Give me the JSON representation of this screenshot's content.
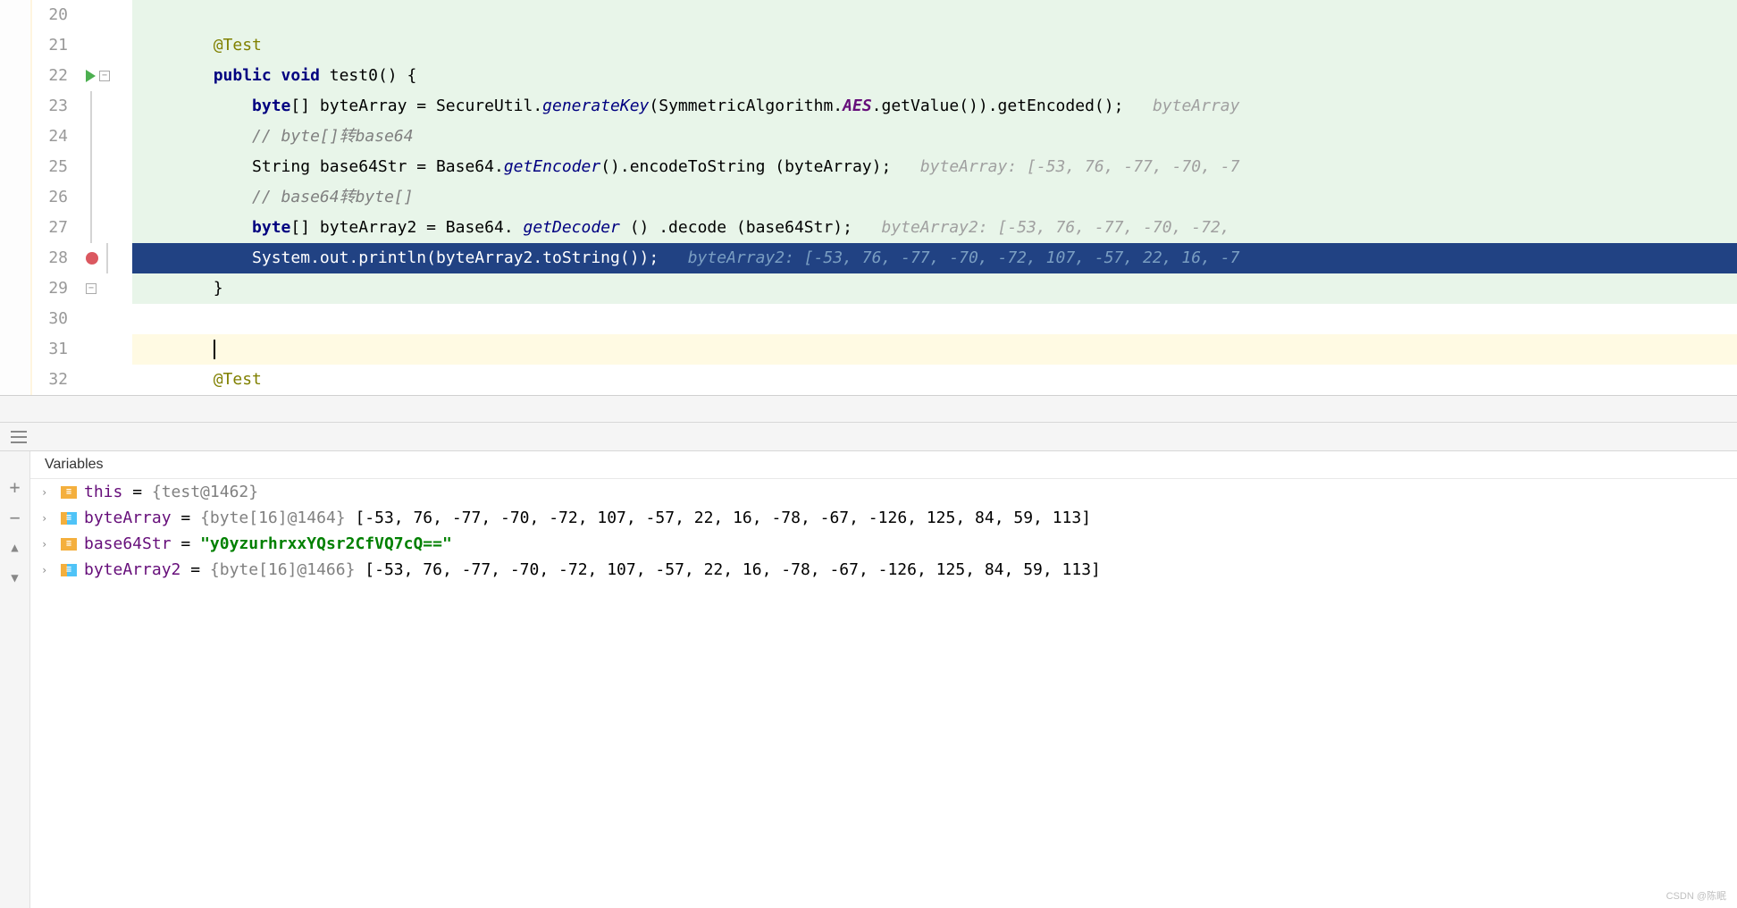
{
  "editor": {
    "lines": [
      {
        "num": "20",
        "bg": "green",
        "indent": "",
        "content": ""
      },
      {
        "num": "21",
        "bg": "green",
        "indent": "        ",
        "segments": [
          {
            "cls": "anno",
            "t": "@Test"
          }
        ]
      },
      {
        "num": "22",
        "bg": "green",
        "run": true,
        "fold": "-",
        "indent": "        ",
        "segments": [
          {
            "cls": "kw",
            "t": "public void"
          },
          {
            "cls": "",
            "t": " test0() {"
          }
        ]
      },
      {
        "num": "23",
        "bg": "green",
        "foldline": true,
        "indent": "            ",
        "segments": [
          {
            "cls": "kw",
            "t": "byte"
          },
          {
            "cls": "",
            "t": "[] byteArray = SecureUtil."
          },
          {
            "cls": "static-ital",
            "t": "generateKey"
          },
          {
            "cls": "",
            "t": "(SymmetricAlgorithm."
          },
          {
            "cls": "const-ital",
            "t": "AES"
          },
          {
            "cls": "",
            "t": ".getValue()).getEncoded();   "
          },
          {
            "cls": "hint",
            "t": "byteArray"
          }
        ]
      },
      {
        "num": "24",
        "bg": "green",
        "foldline": true,
        "indent": "            ",
        "segments": [
          {
            "cls": "comment",
            "t": "// byte[]转base64"
          }
        ]
      },
      {
        "num": "25",
        "bg": "green",
        "foldline": true,
        "indent": "            ",
        "segments": [
          {
            "cls": "",
            "t": "String base64Str = Base64."
          },
          {
            "cls": "static-ital",
            "t": "getEncoder"
          },
          {
            "cls": "",
            "t": "().encodeToString (byteArray);   "
          },
          {
            "cls": "hint",
            "t": "byteArray: [-53, 76, -77, -70, -7"
          }
        ]
      },
      {
        "num": "26",
        "bg": "green",
        "foldline": true,
        "indent": "            ",
        "segments": [
          {
            "cls": "comment",
            "t": "// base64转byte[]"
          }
        ]
      },
      {
        "num": "27",
        "bg": "green",
        "foldline": true,
        "indent": "            ",
        "segments": [
          {
            "cls": "kw",
            "t": "byte"
          },
          {
            "cls": "",
            "t": "[] byteArray2 = Base64. "
          },
          {
            "cls": "static-ital",
            "t": "getDecoder"
          },
          {
            "cls": "",
            "t": " () .decode (base64Str);   "
          },
          {
            "cls": "hint",
            "t": "byteArray2: [-53, 76, -77, -70, -72,"
          }
        ]
      },
      {
        "num": "28",
        "bg": "selected",
        "breakpoint": true,
        "foldline": true,
        "indent": "            ",
        "segments": [
          {
            "cls": "",
            "t": "System."
          },
          {
            "cls": "kw-inline",
            "t": "out"
          },
          {
            "cls": "",
            "t": ".println(byteArray2.toString());   "
          },
          {
            "cls": "hint-inline",
            "t": "byteArray2: [-53, 76, -77, -70, -72, 107, -57, 22, 16, -7"
          }
        ]
      },
      {
        "num": "29",
        "bg": "green",
        "fold": "-",
        "indent": "        ",
        "segments": [
          {
            "cls": "",
            "t": "}"
          }
        ]
      },
      {
        "num": "30",
        "bg": "none",
        "indent": "",
        "content": ""
      },
      {
        "num": "31",
        "bg": "highlight",
        "cursor": true,
        "indent": "        "
      },
      {
        "num": "32",
        "bg": "none",
        "indent": "        ",
        "segments": [
          {
            "cls": "anno",
            "t": "@Test"
          }
        ]
      }
    ]
  },
  "debugger": {
    "tab_label": "Variables",
    "vars": [
      {
        "icon": "obj",
        "name": "this",
        "eq": " = ",
        "gray": "{test@1462}",
        "rest": ""
      },
      {
        "icon": "arr",
        "name": "byteArray",
        "eq": " = ",
        "gray": "{byte[16]@1464} ",
        "rest": "[-53, 76, -77, -70, -72, 107, -57, 22, 16, -78, -67, -126, 125, 84, 59, 113]"
      },
      {
        "icon": "obj",
        "name": "base64Str",
        "eq": " = ",
        "green": "\"y0yzurhrxxYQsr2CfVQ7cQ==\""
      },
      {
        "icon": "arr",
        "name": "byteArray2",
        "eq": " = ",
        "gray": "{byte[16]@1466} ",
        "rest": "[-53, 76, -77, -70, -72, 107, -57, 22, 16, -78, -67, -126, 125, 84, 59, 113]"
      }
    ]
  },
  "watermark": "CSDN @陈眠"
}
